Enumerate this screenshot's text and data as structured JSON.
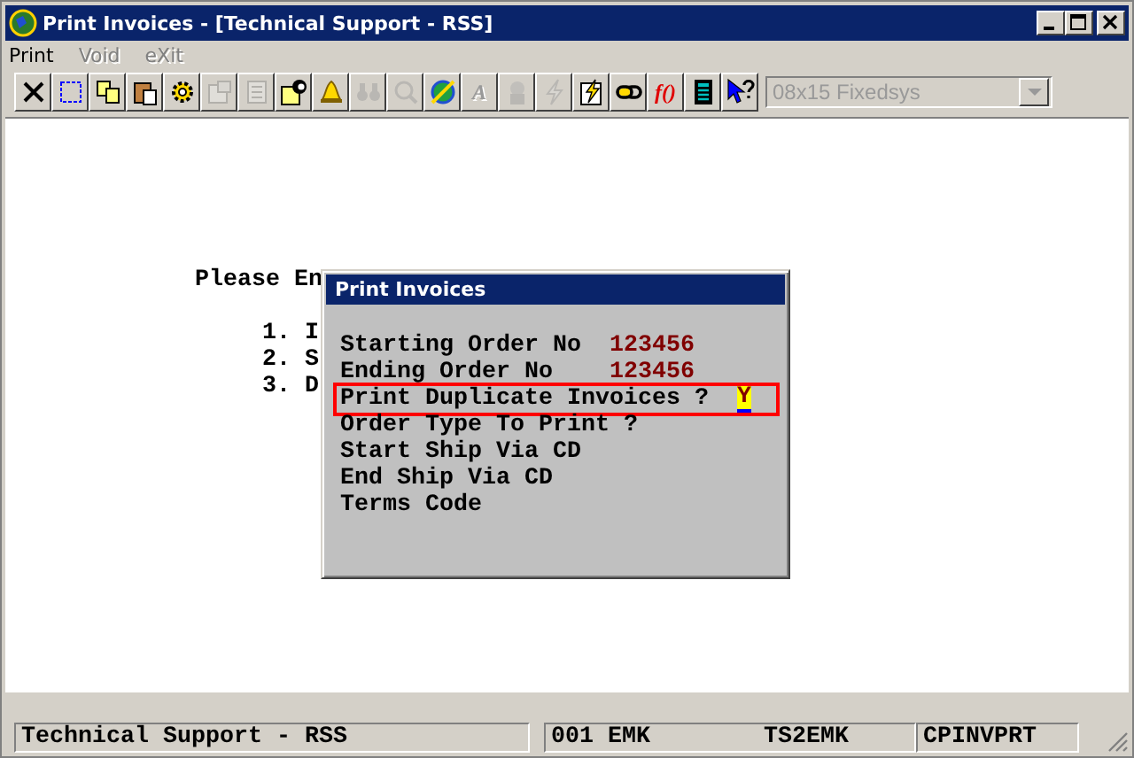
{
  "window": {
    "title": "Print Invoices - [Technical Support - RSS]"
  },
  "menu": [
    {
      "label": "Print",
      "disabled": false
    },
    {
      "label": "Void",
      "disabled": true
    },
    {
      "label": "eXit",
      "disabled": true
    }
  ],
  "toolbar": [
    {
      "kind": "close",
      "disabled": false
    },
    {
      "kind": "select",
      "disabled": false
    },
    {
      "kind": "copy",
      "disabled": false
    },
    {
      "kind": "paste",
      "disabled": false
    },
    {
      "kind": "gear",
      "disabled": false
    },
    {
      "kind": "properties",
      "disabled": true
    },
    {
      "kind": "list",
      "disabled": true
    },
    {
      "kind": "contact",
      "disabled": false
    },
    {
      "kind": "bell",
      "disabled": false
    },
    {
      "kind": "binoculars",
      "disabled": true
    },
    {
      "kind": "search",
      "disabled": true
    },
    {
      "kind": "globe",
      "disabled": false
    },
    {
      "kind": "glyph",
      "glyph": "A",
      "disabled": true
    },
    {
      "kind": "head",
      "disabled": true
    },
    {
      "kind": "lightning",
      "disabled": true
    },
    {
      "kind": "lightning-page",
      "disabled": false
    },
    {
      "kind": "link",
      "disabled": false
    },
    {
      "kind": "glyph",
      "glyph": "f()",
      "disabled": false
    },
    {
      "kind": "calculator",
      "disabled": false
    },
    {
      "kind": "help",
      "disabled": false
    }
  ],
  "font_select": {
    "value": "08x15 Fixedsys",
    "disabled": true
  },
  "terminal_heading": "Please En",
  "terminal_lines": [
    "1. I",
    "2. S",
    "3. D"
  ],
  "dialog": {
    "title": "Print Invoices",
    "fields": [
      {
        "label": "Starting Order No",
        "value": "123456",
        "selected": false
      },
      {
        "label": "Ending Order No",
        "value": "123456",
        "selected": false
      },
      {
        "label": "Print Duplicate Invoices ?",
        "value": "Y",
        "selected": true
      },
      {
        "label": "Order Type To Print ?",
        "selected": false
      },
      {
        "label": "Start Ship Via CD",
        "selected": false
      },
      {
        "label": "End Ship Via CD",
        "selected": false
      },
      {
        "label": "Terms Code",
        "selected": false
      }
    ]
  },
  "status_bar": [
    [
      "Technical Support - RSS"
    ],
    [
      "001 EMK",
      "TS2EMK"
    ],
    [
      "CPINVPRT"
    ]
  ]
}
